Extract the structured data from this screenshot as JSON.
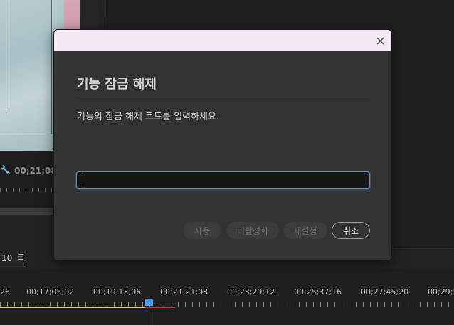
{
  "source_monitor": {
    "timecode": "00;21;08",
    "wrench_icon": "wrench-icon"
  },
  "timeline": {
    "sequence_tab": "10",
    "menu_icon": "hamburger-menu-icon",
    "ruler_labels": [
      "26",
      "00;17;05;02",
      "00;19;13;06",
      "00;21;21;08",
      "00;23;29;12",
      "00;25;37;16",
      "00;27;45;20",
      "00;29;5"
    ],
    "playhead_color": "#4a9df2",
    "work_area_color": "#e0d12a"
  },
  "dialog": {
    "title": "기능 잠금 해제",
    "description": "기능의 잠금 해제 코드를 입력하세요.",
    "code_input": {
      "value": "",
      "placeholder": ""
    },
    "buttons": {
      "use": "사용",
      "deactivate": "비활성화",
      "reset": "재설정",
      "cancel": "취소"
    },
    "close_icon": "close-icon",
    "accent_color": "#4a8ed6"
  }
}
